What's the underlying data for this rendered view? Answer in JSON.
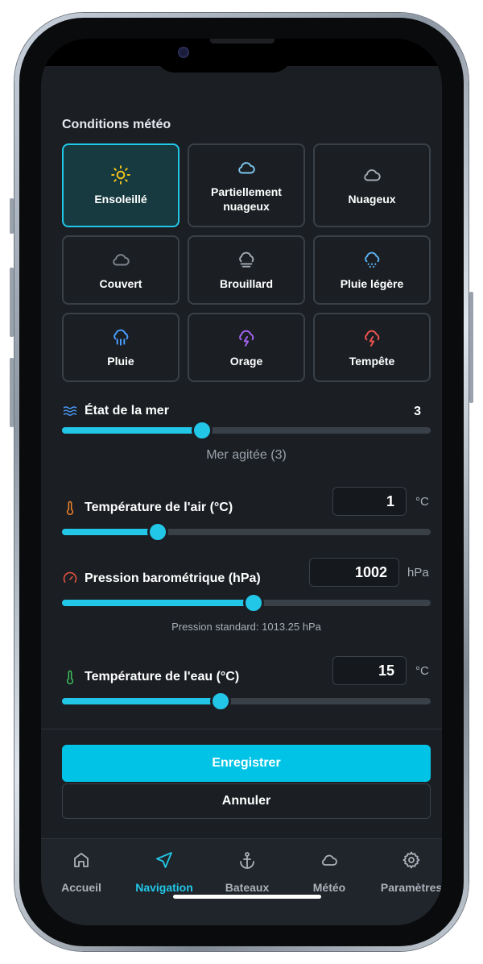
{
  "weather": {
    "title": "Conditions météo",
    "options": [
      {
        "label": "Ensoleillé",
        "icon": "sun-icon",
        "selected": true
      },
      {
        "label": "Partiellement nuageux",
        "icon": "cloud-icon"
      },
      {
        "label": "Nuageux",
        "icon": "cloud-icon"
      },
      {
        "label": "Couvert",
        "icon": "cloud-icon"
      },
      {
        "label": "Brouillard",
        "icon": "fog-icon"
      },
      {
        "label": "Pluie légère",
        "icon": "light-rain-icon"
      },
      {
        "label": "Pluie",
        "icon": "rain-icon"
      },
      {
        "label": "Orage",
        "icon": "thunderstorm-icon"
      },
      {
        "label": "Tempête",
        "icon": "storm-icon"
      }
    ]
  },
  "sea": {
    "label": "État de la mer",
    "value": "3",
    "level": 0.38,
    "description": "Mer agitée (3)"
  },
  "air_temp": {
    "label": "Température de l'air (°C)",
    "value": "1",
    "unit": "°C",
    "level": 0.26
  },
  "pressure": {
    "label": "Pression barométrique (hPa)",
    "value": "1002",
    "unit": "hPa",
    "level": 0.52,
    "note": "Pression standard: 1013.25 hPa"
  },
  "water_temp": {
    "label": "Température de l'eau (°C)",
    "value": "15",
    "unit": "°C",
    "level": 0.43
  },
  "actions": {
    "save": "Enregistrer",
    "cancel": "Annuler"
  },
  "tabs": [
    {
      "label": "Accueil",
      "icon": "home-icon"
    },
    {
      "label": "Navigation",
      "icon": "navigation-icon",
      "active": true
    },
    {
      "label": "Bateaux",
      "icon": "anchor-icon"
    },
    {
      "label": "Météo",
      "icon": "cloud-icon"
    },
    {
      "label": "Paramètres",
      "icon": "gear-icon"
    }
  ],
  "colors": {
    "accent": "#22c7e8",
    "primary_button": "#00c3e6",
    "background": "#1b1f24",
    "sun": "#f5c518",
    "partly_cloud": "#7cc7f0",
    "light_rain": "#5ab0f0",
    "rain": "#4a9eff",
    "thunder": "#a463f2",
    "storm": "#ef5350",
    "air_thermo": "#f5842a",
    "pressure_gauge": "#e8533e",
    "water_thermo": "#3fbf5a"
  }
}
